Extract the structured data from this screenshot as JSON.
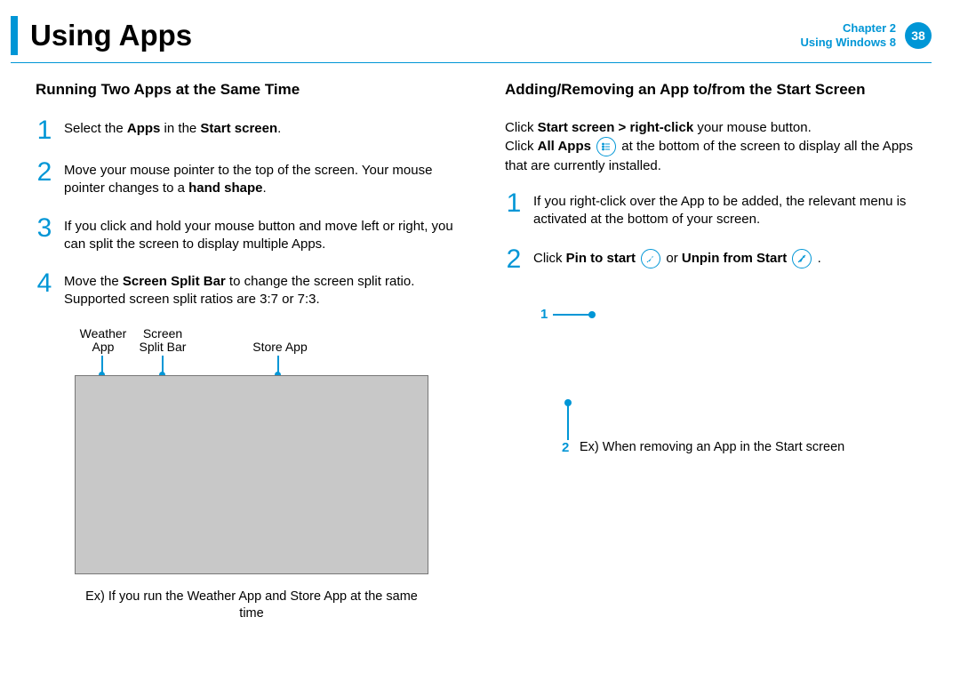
{
  "header": {
    "title": "Using Apps",
    "chapter_line1": "Chapter 2",
    "chapter_line2": "Using Windows 8",
    "page_number": "38"
  },
  "left": {
    "section_title": "Running Two Apps at the Same Time",
    "steps": [
      {
        "num": "1",
        "pre": "Select the ",
        "b1": "Apps",
        "mid": " in the ",
        "b2": "Start screen",
        "post": "."
      },
      {
        "num": "2",
        "pre": " Move your mouse pointer to the top of the screen. Your mouse pointer changes to a ",
        "b1": "hand shape",
        "mid": "",
        "b2": "",
        "post": "."
      },
      {
        "num": "3",
        "pre": "If you click and hold your mouse button and move left or right, you can split the screen to display multiple Apps.",
        "b1": "",
        "mid": "",
        "b2": "",
        "post": ""
      },
      {
        "num": "4",
        "pre": "Move the ",
        "b1": "Screen Split Bar",
        "mid": " to change the screen split ratio. Supported screen split ratios are 3:7 or 7:3.",
        "b2": "",
        "post": ""
      }
    ],
    "figure": {
      "label_weather": "Weather\nApp",
      "label_split": "Screen\nSplit Bar",
      "label_store": "Store App",
      "caption": "Ex) If you run the Weather App and Store App at the same time"
    }
  },
  "right": {
    "section_title": "Adding/Removing an App to/from the Start Screen",
    "intro_seg1": "Click ",
    "intro_b1": "Start screen > right-click",
    "intro_seg2": " your mouse button.",
    "intro_seg3": "Click ",
    "intro_b2": "All Apps",
    "intro_seg4": " at the bottom of the screen to display all the Apps that are currently installed.",
    "steps": [
      {
        "num": "1",
        "text": "If you right-click over the App to be added, the relevant menu is activated at the bottom of your screen."
      },
      {
        "num": "2",
        "pre": "Click ",
        "b1": "Pin to start",
        "mid": " or ",
        "b2": "Unpin from Start",
        "post": " ."
      }
    ],
    "callouts": {
      "c1": "1",
      "c2": "2",
      "caption": "Ex) When removing an App in the Start screen"
    }
  }
}
